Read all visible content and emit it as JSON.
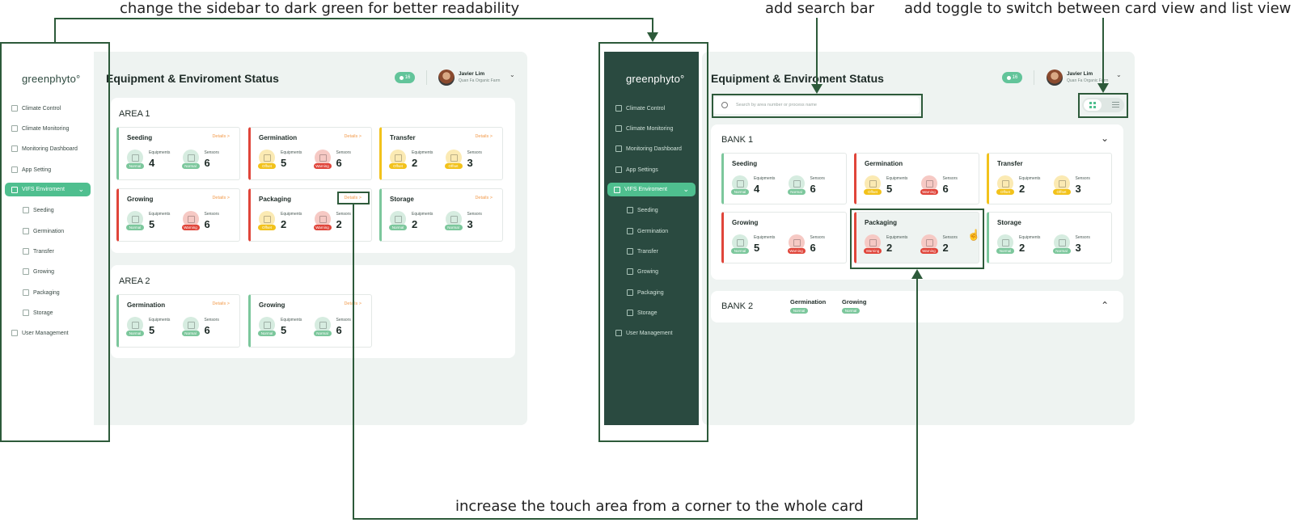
{
  "annotations": {
    "sidebar_color": "change the sidebar to dark green for better readability",
    "search_bar": "add search bar",
    "view_toggle": "add toggle to switch between card view and list view",
    "touch_area": "increase the touch area from a corner to the whole card"
  },
  "colors": {
    "annotation_green": "#2d5a3a",
    "sidebar_dark": "#2a4a40",
    "accent": "#4fbf8f",
    "normal": "#7cc79c",
    "offset": "#f2c21b",
    "warning": "#e0453a",
    "details_link": "#f29a4a"
  },
  "before": {
    "logo": "greenphyto°",
    "title": "Equipment & Enviroment Status",
    "notifications": "16",
    "user": {
      "name": "Javier Lim",
      "farm": "Quan Fa Organic Farm"
    },
    "nav": {
      "climate_control": "Climate Control",
      "climate_monitoring": "Climate Monitoring",
      "monitoring_dashboard": "Monitoring Dashboard",
      "app_setting": "App Setting",
      "vifs": "VIFS Enviroment",
      "seeding": "Seeding",
      "germination": "Germination",
      "transfer": "Transfer",
      "growing": "Growing",
      "packaging": "Packaging",
      "storage": "Storage",
      "user_management": "User Management"
    },
    "area1": {
      "title": "AREA 1",
      "cards": [
        {
          "name": "Seeding",
          "details": "Details >",
          "eq_label": "Equipments",
          "eq": "4",
          "eq_status": "Normal",
          "se_label": "Sensors",
          "se": "6",
          "se_status": "Normal"
        },
        {
          "name": "Germination",
          "details": "Details >",
          "eq_label": "Equipments",
          "eq": "5",
          "eq_status": "Offset",
          "se_label": "Sensors",
          "se": "6",
          "se_status": "Warning"
        },
        {
          "name": "Transfer",
          "details": "Details >",
          "eq_label": "Equipments",
          "eq": "2",
          "eq_status": "Offset",
          "se_label": "Sensors",
          "se": "3",
          "se_status": "Offset"
        },
        {
          "name": "Growing",
          "details": "Details >",
          "eq_label": "Equipments",
          "eq": "5",
          "eq_status": "Normal",
          "se_label": "Sensors",
          "se": "6",
          "se_status": "Warning"
        },
        {
          "name": "Packaging",
          "details": "Details >",
          "eq_label": "Equipments",
          "eq": "2",
          "eq_status": "Offset",
          "se_label": "Sensors",
          "se": "2",
          "se_status": "Warning"
        },
        {
          "name": "Storage",
          "details": "Details >",
          "eq_label": "Equipments",
          "eq": "2",
          "eq_status": "Normal",
          "se_label": "Sensors",
          "se": "3",
          "se_status": "Normal"
        }
      ]
    },
    "area2": {
      "title": "AREA 2",
      "cards": [
        {
          "name": "Germination",
          "details": "Details >",
          "eq_label": "Equipments",
          "eq": "5",
          "eq_status": "Normal",
          "se_label": "Sensors",
          "se": "6",
          "se_status": "Normal"
        },
        {
          "name": "Growing",
          "details": "Details >",
          "eq_label": "Equipments",
          "eq": "5",
          "eq_status": "Normal",
          "se_label": "Sensors",
          "se": "6",
          "se_status": "Normal"
        }
      ]
    }
  },
  "after": {
    "logo": "greenphyto°",
    "title": "Equipment & Enviroment Status",
    "notifications": "16",
    "user": {
      "name": "Javier Lim",
      "farm": "Quan Fa Organic Farm"
    },
    "search_placeholder": "Search by area number or process name",
    "nav": {
      "climate_control": "Climate Control",
      "climate_monitoring": "Climate Monitoring",
      "monitoring_dashboard": "Monitoring Dashboard",
      "app_settings": "App Settings",
      "vifs": "VIFS Enviroment",
      "seeding": "Seeding",
      "germination": "Germination",
      "transfer": "Transfer",
      "growing": "Growing",
      "packaging": "Packaging",
      "storage": "Storage",
      "user_management": "User Management"
    },
    "bank1": {
      "title": "BANK 1",
      "cards": [
        {
          "name": "Seeding",
          "eq_label": "Equipments",
          "eq": "4",
          "eq_status": "Normal",
          "se_label": "Sensors",
          "se": "6",
          "se_status": "Normal"
        },
        {
          "name": "Germination",
          "eq_label": "Equipments",
          "eq": "5",
          "eq_status": "Offset",
          "se_label": "Sensors",
          "se": "6",
          "se_status": "Warning"
        },
        {
          "name": "Transfer",
          "eq_label": "Equipments",
          "eq": "2",
          "eq_status": "Offset",
          "se_label": "Sensors",
          "se": "3",
          "se_status": "Offset"
        },
        {
          "name": "Growing",
          "eq_label": "Equipments",
          "eq": "5",
          "eq_status": "Normal",
          "se_label": "Sensors",
          "se": "6",
          "se_status": "Warning"
        },
        {
          "name": "Packaging",
          "eq_label": "Equipments",
          "eq": "2",
          "eq_status": "Warning",
          "se_label": "Sensors",
          "se": "2",
          "se_status": "Warning"
        },
        {
          "name": "Storage",
          "eq_label": "Equipments",
          "eq": "2",
          "eq_status": "Normal",
          "se_label": "Sensors",
          "se": "3",
          "se_status": "Normal"
        }
      ]
    },
    "bank2": {
      "title": "BANK 2",
      "tags": [
        {
          "name": "Germination",
          "status": "Normal"
        },
        {
          "name": "Growing",
          "status": "Normal"
        }
      ]
    }
  }
}
